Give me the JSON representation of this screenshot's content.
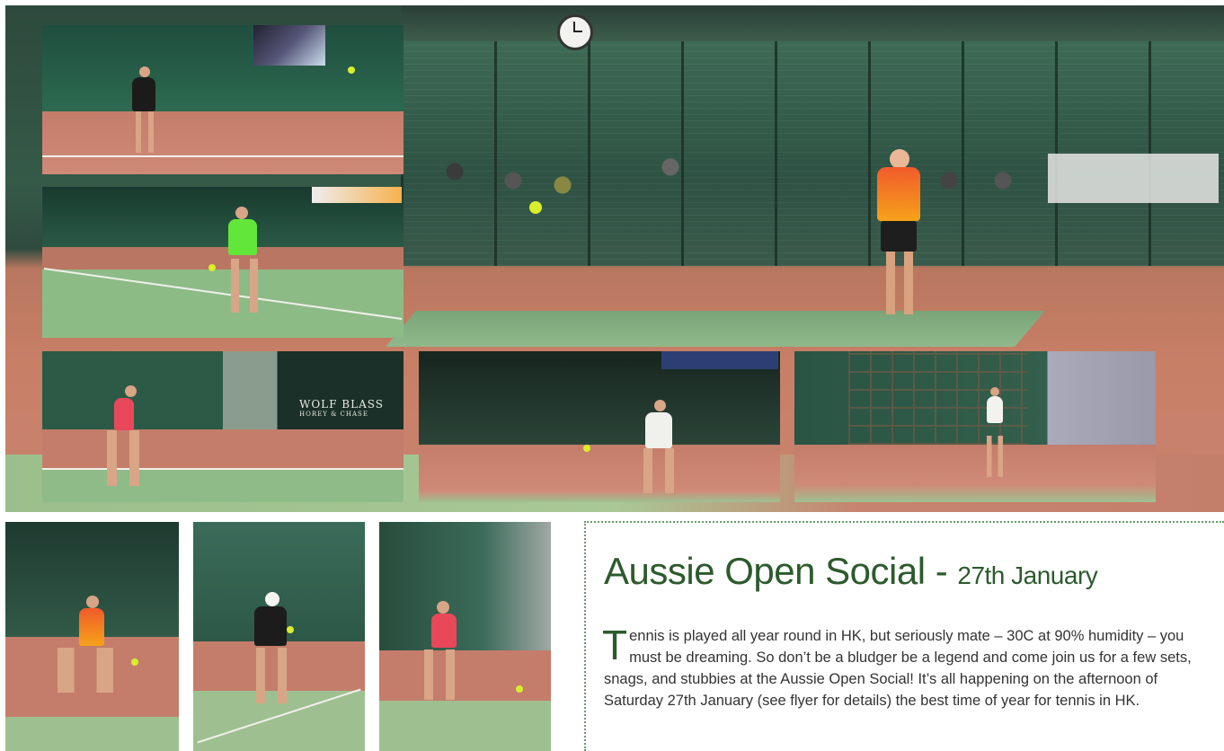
{
  "article": {
    "title": "Aussie Open Social - ",
    "title_date": "27th January",
    "dropcap": "T",
    "body": "ennis is played all year round in HK, but seriously mate – 30C at 90% humidity – you must be dreaming. So don’t be a bludger be a legend and come join us for a few sets, snags, and stubbies at the Aussie Open Social! It’s all happening on the afternoon of Saturday 27th January (see flyer for details) the best time of year for tennis in HK."
  },
  "photos": {
    "sponsor_sign_line1": "WOLF BLASS",
    "sponsor_sign_line2": "HOREY & CHASE"
  },
  "colors": {
    "title_green": "#2d5a2d",
    "border_dotted": "#6a9a6a",
    "court_clay": "#c77f66",
    "court_green": "#8fb98a"
  }
}
